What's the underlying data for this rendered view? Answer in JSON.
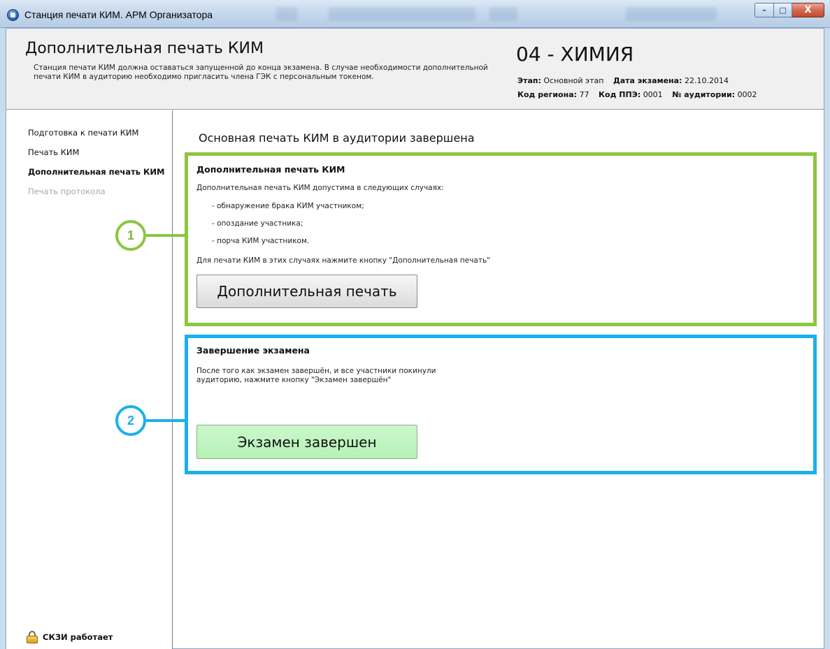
{
  "window": {
    "title": "Станция печати КИМ. АРМ Организатора",
    "controls": {
      "minimize": "–",
      "maximize": "□",
      "close": "X"
    }
  },
  "header": {
    "title": "Дополнительная печать КИМ",
    "description": "Станция печати КИМ должна оставаться запущенной до конца экзамена. В случае необходимости дополнительной печати КИМ в аудиторию необходимо пригласить члена ГЭК с персональным токеном.",
    "subject": "04 - ХИМИЯ",
    "stage_label": "Этап:",
    "stage_value": "Основной этап",
    "exam_date_label": "Дата экзамена:",
    "exam_date_value": "22.10.2014",
    "region_label": "Код региона:",
    "region_value": "77",
    "ppe_label": "Код ППЭ:",
    "ppe_value": "0001",
    "room_label": "№ аудитории:",
    "room_value": "0002"
  },
  "sidebar": {
    "items": [
      {
        "label": "Подготовка к печати КИМ",
        "state": "normal"
      },
      {
        "label": "Печать КИМ",
        "state": "normal"
      },
      {
        "label": "Дополнительная печать КИМ",
        "state": "active"
      },
      {
        "label": "Печать протокола",
        "state": "disabled"
      }
    ],
    "status": "СКЗИ работает",
    "status_icon": "lock-icon"
  },
  "main": {
    "title": "Основная печать КИМ в аудитории завершена",
    "extra_print": {
      "title": "Дополнительная печать КИМ",
      "intro": "Дополнительная печать КИМ допустима в следующих случаях:",
      "cases": [
        "- обнаружение брака КИМ участником;",
        "- опоздание участника;",
        "- порча КИМ участником."
      ],
      "instruction": "Для печати КИМ в этих случаях нажмите кнопку \"Дополнительная печать\"",
      "button_label": "Дополнительная печать"
    },
    "finish": {
      "title": "Завершение экзамена",
      "text": "После того как экзамен завершён, и все участники покинули аудиторию, нажмите кнопку \"Экзамен завершён\"",
      "button_label": "Экзамен завершен"
    }
  },
  "callouts": [
    "1",
    "2"
  ],
  "colors": {
    "callout_1": "#8cc63f",
    "callout_2": "#1ab0ec",
    "finish_button": "#b5f2b5"
  }
}
